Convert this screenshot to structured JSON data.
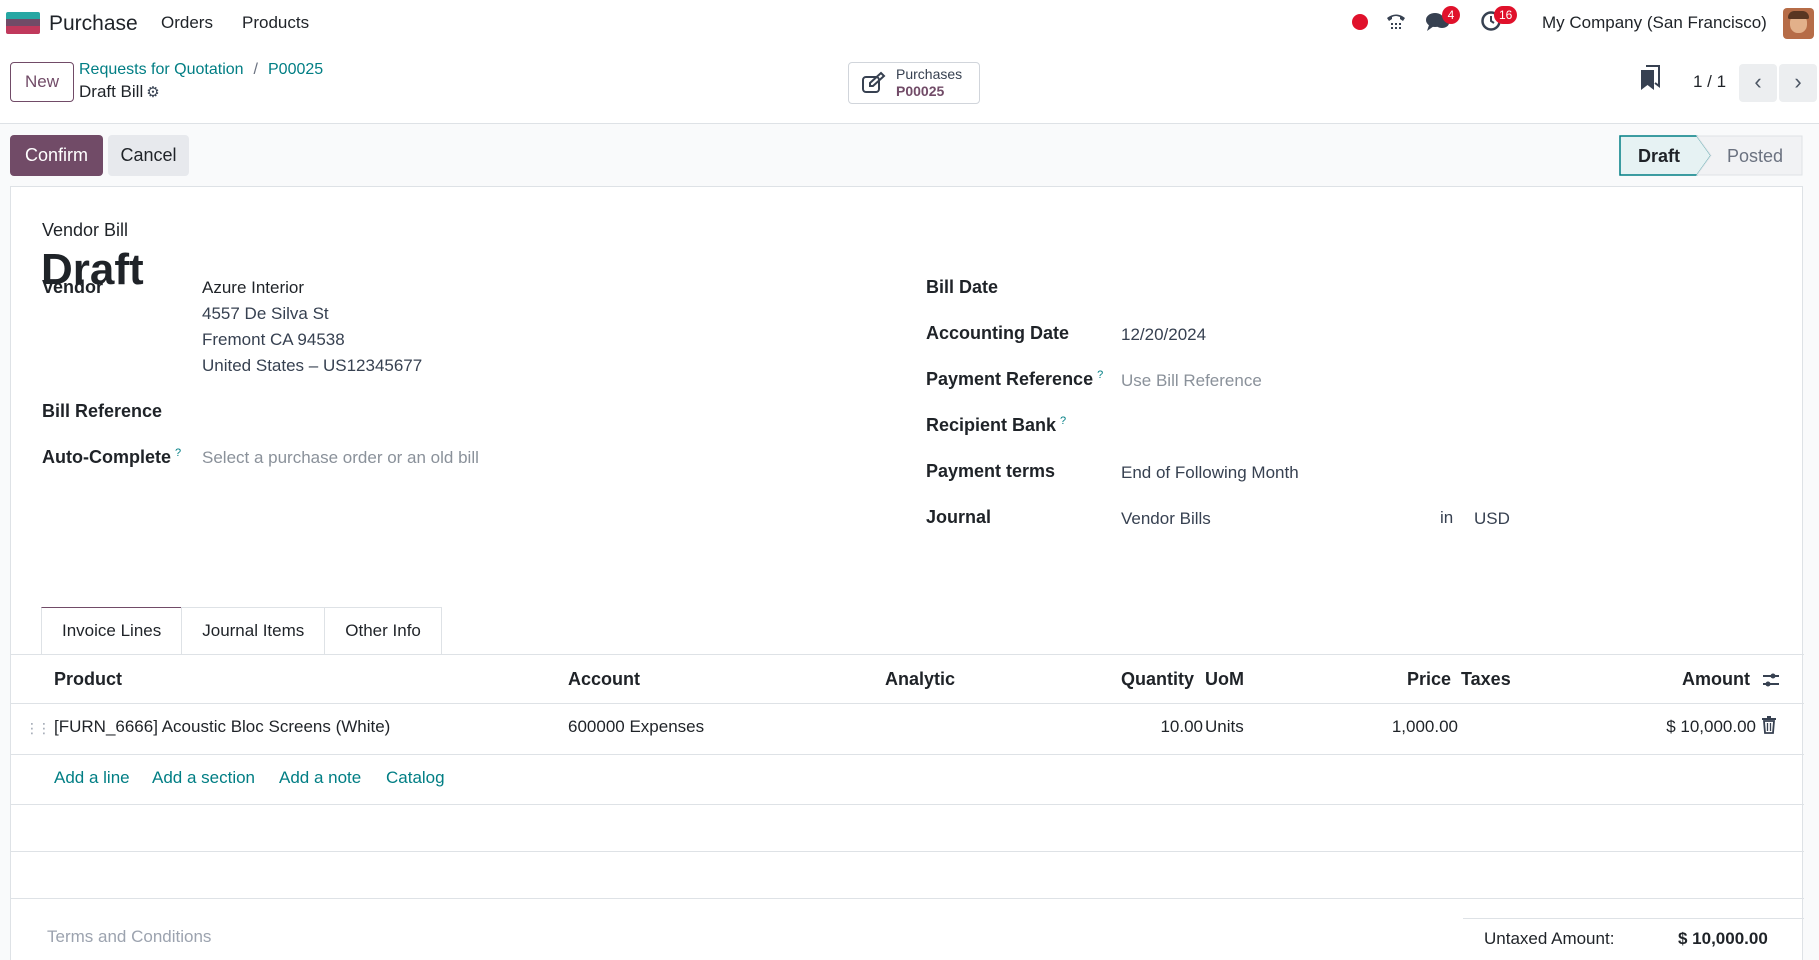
{
  "navbar": {
    "app_name": "Purchase",
    "menu": [
      "Orders",
      "Products"
    ],
    "messages_count": "4",
    "activities_count": "16",
    "company": "My Company (San Francisco)"
  },
  "control": {
    "new_label": "New",
    "breadcrumb": [
      "Requests for Quotation",
      "P00025"
    ],
    "record_title": "Draft Bill",
    "smart_button": {
      "label": "Purchases",
      "value": "P00025"
    },
    "pager": "1 / 1"
  },
  "statusbar": {
    "confirm_label": "Confirm",
    "cancel_label": "Cancel",
    "stages": [
      "Draft",
      "Posted"
    ],
    "active_stage": "Draft"
  },
  "form": {
    "doc_type": "Vendor Bill",
    "title": "Draft",
    "vendor_label": "Vendor",
    "vendor_name": "Azure Interior",
    "vendor_address": [
      "4557 De Silva St",
      "Fremont CA 94538",
      "United States – US12345677"
    ],
    "bill_reference_label": "Bill Reference",
    "auto_complete_label": "Auto-Complete",
    "auto_complete_placeholder": "Select a purchase order or an old bill",
    "bill_date_label": "Bill Date",
    "accounting_date_label": "Accounting Date",
    "accounting_date": "12/20/2024",
    "payment_reference_label": "Payment Reference",
    "payment_reference_placeholder": "Use Bill Reference",
    "recipient_bank_label": "Recipient Bank",
    "payment_terms_label": "Payment terms",
    "payment_terms": "End of Following Month",
    "journal_label": "Journal",
    "journal": "Vendor Bills",
    "in_label": "in",
    "currency": "USD",
    "help_mark": "?"
  },
  "tabs": [
    "Invoice Lines",
    "Journal Items",
    "Other Info"
  ],
  "lines": {
    "headers": [
      "Product",
      "Account",
      "Analytic",
      "Quantity",
      "UoM",
      "Price",
      "Taxes",
      "Amount"
    ],
    "rows": [
      {
        "product": "[FURN_6666] Acoustic Bloc Screens (White)",
        "account": "600000 Expenses",
        "analytic": "",
        "quantity": "10.00",
        "uom": "Units",
        "price": "1,000.00",
        "taxes": "",
        "amount": "$ 10,000.00"
      }
    ],
    "actions": [
      "Add a line",
      "Add a section",
      "Add a note",
      "Catalog"
    ]
  },
  "footer": {
    "terms_placeholder": "Terms and Conditions",
    "untaxed_label": "Untaxed Amount:",
    "untaxed_value": "$ 10,000.00"
  },
  "colors": {
    "brand": "#714b67",
    "link": "#017e84",
    "badge": "#e0112b"
  }
}
